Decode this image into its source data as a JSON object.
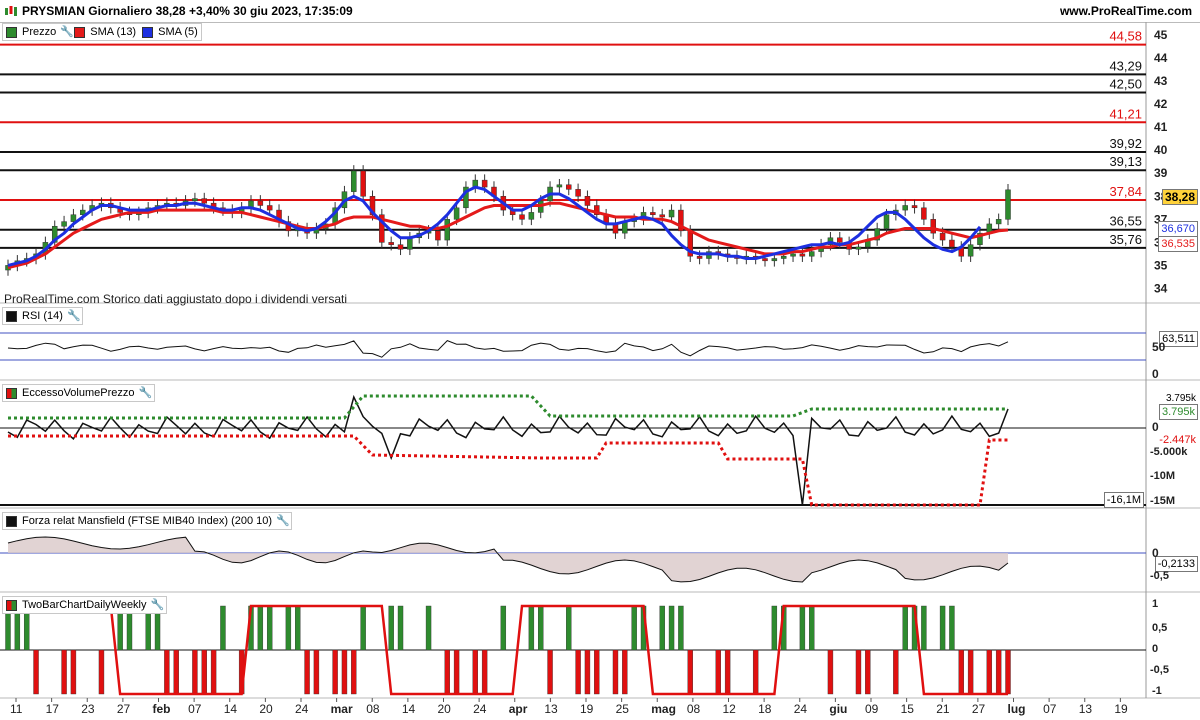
{
  "header": {
    "title": "PRYSMIAN Giornaliero 38,28 +3,40% 30 giu 2023, 17:35:09",
    "site": "www.ProRealTime.com"
  },
  "colors": {
    "up": "#2e8b2e",
    "down": "#e01010",
    "sma13": "#e41a1a",
    "sma5": "#1d2fe0",
    "level_red": "#e01010",
    "level_black": "#111111"
  },
  "panels": {
    "price": {
      "legend": [
        {
          "label": "Prezzo",
          "color": "#2e8b2e"
        },
        {
          "label": "SMA (13)",
          "color": "#e41a1a"
        },
        {
          "label": "SMA (5)",
          "color": "#1d2fe0"
        }
      ],
      "note": "ProRealTime.com Storico dati aggiustato dopo i dividendi versati",
      "last_price": "38,28",
      "sma5_value": "36,670",
      "sma13_value": "36,535"
    },
    "rsi": {
      "label": "RSI (14)",
      "value": "63,511",
      "ticks": [
        "50",
        "0"
      ]
    },
    "volume": {
      "label": "EccessoVolumePrezzo",
      "values": [
        "3.795k",
        "3.795k",
        "-2.447k",
        "-16,1M"
      ],
      "ticks": [
        "0",
        "-5.000k",
        "-10M",
        "-15M"
      ]
    },
    "mansfield": {
      "label": "Forza relat Mansfield (FTSE MIB40 Index) (200 10)",
      "value": "-0,2133",
      "ticks": [
        "0",
        "-0,5"
      ]
    },
    "twobar": {
      "label": "TwoBarChartDailyWeekly",
      "ticks": [
        "1",
        "0,5",
        "0",
        "-0,5",
        "-1"
      ]
    }
  },
  "chart_data": {
    "type": "line",
    "title": "PRYSMIAN Giornaliero",
    "x_labels": [
      "11",
      "17",
      "23",
      "27",
      "feb",
      "07",
      "14",
      "20",
      "24",
      "mar",
      "08",
      "14",
      "20",
      "24",
      "apr",
      "13",
      "19",
      "25",
      "mag",
      "08",
      "12",
      "18",
      "24",
      "giu",
      "09",
      "15",
      "21",
      "27",
      "lug",
      "07",
      "13",
      "19"
    ],
    "y_ticks": [
      34,
      35,
      36,
      37,
      38,
      39,
      40,
      41,
      42,
      43,
      44,
      45
    ],
    "ylim": [
      33.5,
      45.3
    ],
    "levels": [
      {
        "value": 44.58,
        "label": "44,58",
        "color": "red"
      },
      {
        "value": 43.29,
        "label": "43,29",
        "color": "black"
      },
      {
        "value": 42.5,
        "label": "42,50",
        "color": "black"
      },
      {
        "value": 41.21,
        "label": "41,21",
        "color": "red"
      },
      {
        "value": 39.92,
        "label": "39,92",
        "color": "black"
      },
      {
        "value": 39.13,
        "label": "39,13",
        "color": "black"
      },
      {
        "value": 37.84,
        "label": "37,84",
        "color": "red"
      },
      {
        "value": 36.55,
        "label": "36,55",
        "color": "black"
      },
      {
        "value": 35.76,
        "label": "35,76",
        "color": "black"
      }
    ],
    "series": [
      {
        "name": "Prezzo",
        "values": [
          35.0,
          35.2,
          35.3,
          35.5,
          36.0,
          36.7,
          36.9,
          37.2,
          37.4,
          37.6,
          37.7,
          37.5,
          37.3,
          37.2,
          37.3,
          37.5,
          37.6,
          37.7,
          37.6,
          37.8,
          37.9,
          37.7,
          37.5,
          37.4,
          37.3,
          37.5,
          37.8,
          37.6,
          37.4,
          36.9,
          36.5,
          36.6,
          36.4,
          36.6,
          36.8,
          37.5,
          38.2,
          39.1,
          38.0,
          37.2,
          36.0,
          35.9,
          35.7,
          36.2,
          36.4,
          36.5,
          36.1,
          37.0,
          37.5,
          38.4,
          38.7,
          38.4,
          38.0,
          37.4,
          37.2,
          37.0,
          37.3,
          37.8,
          38.4,
          38.5,
          38.3,
          38.0,
          37.6,
          37.2,
          36.8,
          36.4,
          36.9,
          37.0,
          37.3,
          37.2,
          37.1,
          37.4,
          36.5,
          35.4,
          35.3,
          35.6,
          35.5,
          35.4,
          35.3,
          35.4,
          35.3,
          35.2,
          35.3,
          35.4,
          35.5,
          35.4,
          35.6,
          35.9,
          36.2,
          36.0,
          35.7,
          35.8,
          36.1,
          36.6,
          37.2,
          37.4,
          37.6,
          37.5,
          37.0,
          36.4,
          36.1,
          35.8,
          35.4,
          35.9,
          36.4,
          36.8,
          37.0,
          38.28
        ]
      },
      {
        "name": "SMA (13)",
        "values": [
          34.9,
          35.0,
          35.1,
          35.3,
          35.5,
          35.8,
          36.1,
          36.4,
          36.6,
          36.8,
          37.0,
          37.1,
          37.2,
          37.3,
          37.3,
          37.3,
          37.4,
          37.4,
          37.4,
          37.4,
          37.4,
          37.4,
          37.4,
          37.3,
          37.3,
          37.3,
          37.2,
          37.1,
          37.0,
          36.9,
          36.8,
          36.7,
          36.6,
          36.6,
          36.7,
          36.8,
          37.0,
          37.1,
          37.1,
          37.1,
          37.0,
          36.9,
          36.8,
          36.7,
          36.7,
          36.6,
          36.6,
          36.7,
          36.9,
          37.1,
          37.3,
          37.5,
          37.6,
          37.6,
          37.6,
          37.6,
          37.6,
          37.6,
          37.7,
          37.7,
          37.6,
          37.5,
          37.4,
          37.3,
          37.2,
          37.1,
          37.1,
          37.1,
          37.0,
          37.0,
          37.0,
          36.9,
          36.7,
          36.5,
          36.3,
          36.1,
          36.0,
          35.9,
          35.8,
          35.7,
          35.6,
          35.5,
          35.5,
          35.5,
          35.6,
          35.6,
          35.7,
          35.8,
          35.8,
          35.9,
          35.9,
          36.0,
          36.1,
          36.2,
          36.4,
          36.5,
          36.6,
          36.6,
          36.6,
          36.6,
          36.5,
          36.4,
          36.3,
          36.2,
          36.3,
          36.4,
          36.5,
          36.535
        ]
      },
      {
        "name": "SMA (5)",
        "values": [
          35.0,
          35.1,
          35.2,
          35.4,
          35.7,
          36.1,
          36.4,
          36.8,
          37.1,
          37.4,
          37.6,
          37.6,
          37.5,
          37.4,
          37.4,
          37.4,
          37.5,
          37.6,
          37.6,
          37.7,
          37.7,
          37.6,
          37.5,
          37.4,
          37.4,
          37.5,
          37.5,
          37.4,
          37.2,
          37.0,
          36.8,
          36.6,
          36.5,
          36.6,
          36.9,
          37.3,
          37.8,
          38.0,
          37.8,
          37.3,
          36.9,
          36.5,
          36.2,
          36.2,
          36.3,
          36.5,
          36.8,
          37.2,
          37.7,
          38.2,
          38.4,
          38.3,
          38.0,
          37.7,
          37.4,
          37.4,
          37.6,
          37.9,
          38.1,
          38.1,
          37.9,
          37.6,
          37.3,
          37.0,
          36.8,
          36.8,
          36.9,
          37.0,
          37.1,
          37.0,
          36.8,
          36.3,
          35.9,
          35.6,
          35.5,
          35.5,
          35.5,
          35.4,
          35.4,
          35.3,
          35.3,
          35.4,
          35.5,
          35.6,
          35.7,
          35.8,
          35.9,
          35.9,
          36.0,
          35.9,
          36.0,
          36.3,
          36.7,
          37.1,
          37.3,
          37.3,
          37.0,
          36.6,
          36.2,
          35.9,
          35.7,
          35.6,
          35.8,
          36.2,
          36.67
        ]
      }
    ]
  }
}
